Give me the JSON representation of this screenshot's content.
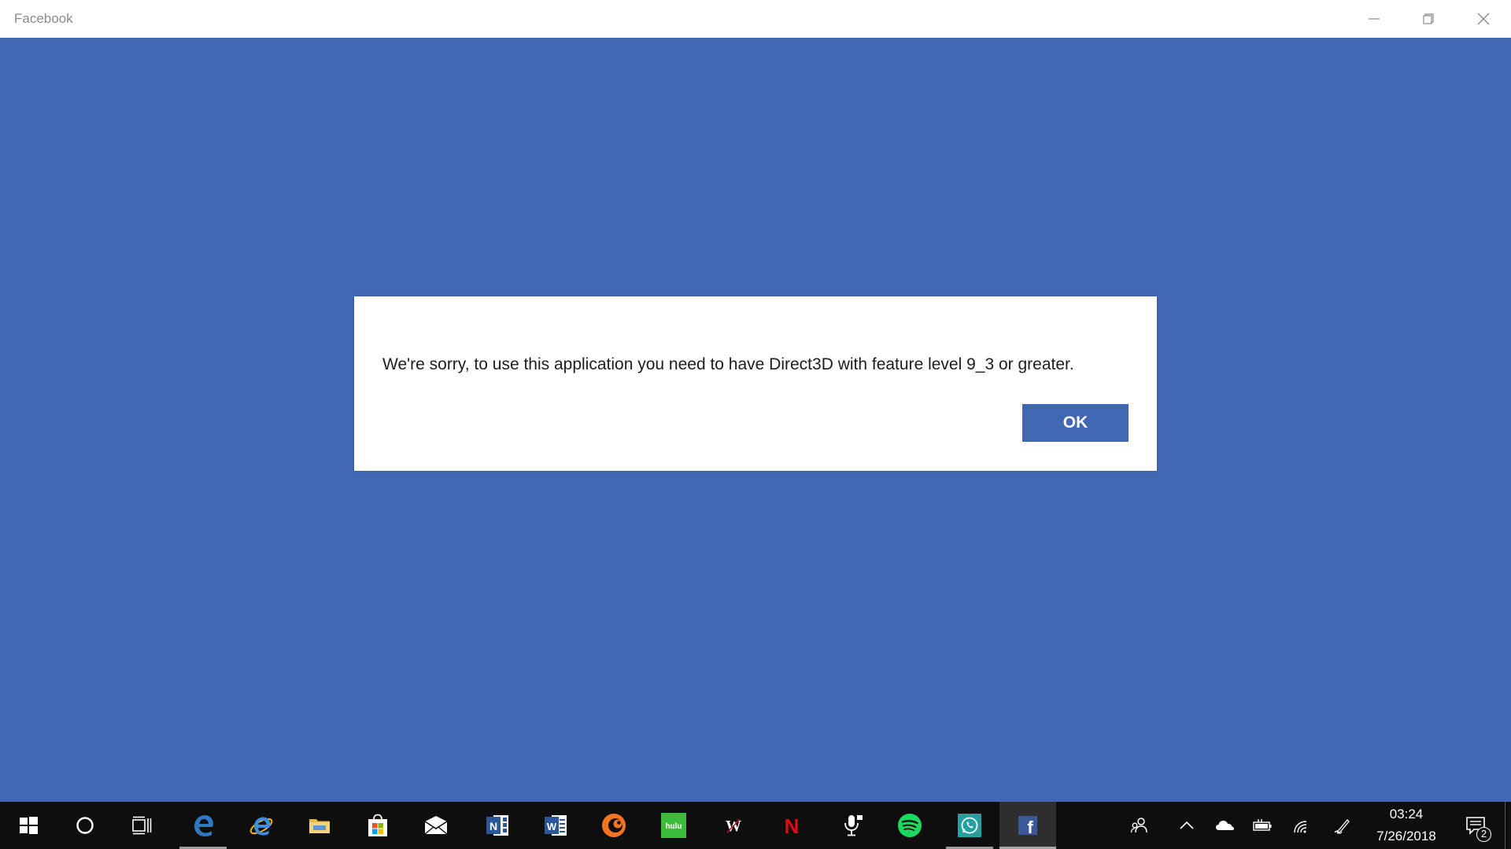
{
  "window": {
    "title": "Facebook",
    "minimize_label": "Minimize",
    "restore_label": "Restore",
    "close_label": "Close"
  },
  "colors": {
    "facebook_blue": "#4267b2",
    "taskbar": "#0e0e0e",
    "dialog_bg": "#ffffff"
  },
  "dialog": {
    "message": "We're sorry, to use this application you need to have Direct3D with feature level 9_3 or greater.",
    "ok_label": "OK"
  },
  "taskbar": {
    "icons": [
      {
        "name": "start-button",
        "icon": "windows-logo-icon"
      },
      {
        "name": "cortana-button",
        "icon": "cortana-circle-icon"
      },
      {
        "name": "task-view-button",
        "icon": "task-view-icon"
      },
      {
        "name": "taskbar-edge",
        "icon": "edge-icon"
      },
      {
        "name": "taskbar-internet-explorer",
        "icon": "internet-explorer-icon"
      },
      {
        "name": "taskbar-file-explorer",
        "icon": "folder-icon"
      },
      {
        "name": "taskbar-store",
        "icon": "store-bag-icon"
      },
      {
        "name": "taskbar-mail",
        "icon": "mail-envelope-icon"
      },
      {
        "name": "taskbar-onenote",
        "icon": "onenote-icon"
      },
      {
        "name": "taskbar-word",
        "icon": "word-icon"
      },
      {
        "name": "taskbar-crunchyroll",
        "icon": "crunchyroll-icon"
      },
      {
        "name": "taskbar-hulu",
        "icon": "hulu-icon",
        "text": "hulu"
      },
      {
        "name": "taskbar-wwe",
        "icon": "wwe-icon",
        "text": "W"
      },
      {
        "name": "taskbar-netflix",
        "icon": "netflix-icon",
        "text": "N"
      },
      {
        "name": "taskbar-voice-recorder",
        "icon": "microphone-icon"
      },
      {
        "name": "taskbar-spotify",
        "icon": "spotify-icon"
      },
      {
        "name": "taskbar-whatsapp",
        "icon": "whatsapp-icon"
      },
      {
        "name": "taskbar-facebook",
        "icon": "facebook-icon",
        "text": "f"
      }
    ],
    "tray": {
      "clock_time": "03:24",
      "clock_date": "7/26/2018",
      "notification_count": "2"
    }
  }
}
